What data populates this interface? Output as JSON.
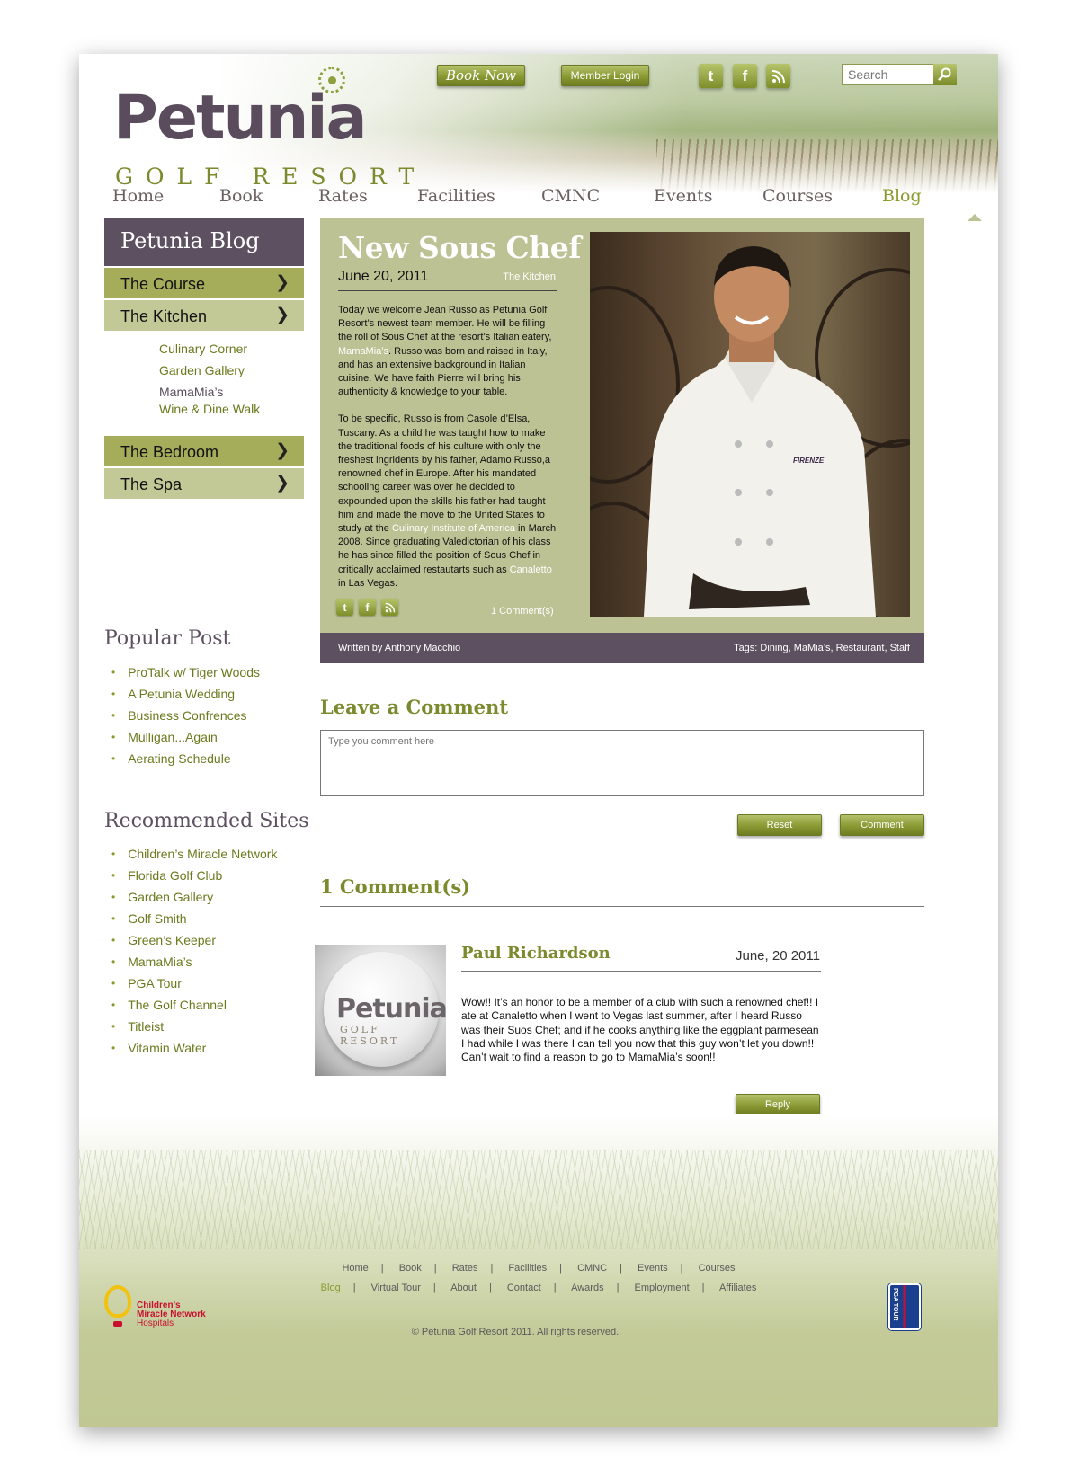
{
  "header": {
    "logo_word": "Petunia",
    "logo_sub": "GOLF RESORT",
    "book_now": "Book Now",
    "member_login": "Member Login",
    "search_placeholder": "Search"
  },
  "nav": [
    "Home",
    "Book",
    "Rates",
    "Facilities",
    "CMNC",
    "Events",
    "Courses",
    "Blog"
  ],
  "sidebar": {
    "title": "Petunia Blog",
    "items": [
      "The Course",
      "The Kitchen",
      "The Bedroom",
      "The Spa"
    ],
    "sub_links": [
      "Culinary Corner",
      "Garden Gallery",
      "MamaMia’s",
      "Wine & Dine Walk"
    ],
    "popular_title": "Popular Post",
    "popular": [
      "ProTalk w/ Tiger Woods",
      "A Petunia Wedding",
      "Business Confrences",
      "Mulligan...Again",
      "Aerating Schedule"
    ],
    "recommended_title": "Recommended Sites",
    "recommended": [
      "Children’s Miracle Network",
      "Florida Golf Club",
      "Garden Gallery",
      "Golf Smith",
      "Green’s Keeper",
      "MamaMia’s",
      "PGA Tour",
      "The Golf Channel",
      "Titleist",
      "Vitamin Water"
    ]
  },
  "post": {
    "title": "New Sous Chef",
    "date": "June 20, 2011",
    "category": "The Kitchen",
    "p1_a": "Today we welcome Jean Russo as Petunia Golf Resort’s newest team member. He will be filling the roll of Sous Chef at the resort’s Italian eatery, ",
    "p1_link": "MamaMia’s",
    "p1_b": ". Russo was born and raised in Italy, and has an extensive background in Italian cuisine. We have faith Pierre will bring his authenticity & knowledge to your table.",
    "p2_a": "To be specific, Russo is from Casole d’Elsa, Tuscany. As a child he was taught how to make the traditional foods of his culture with only the freshest ingridents by his father, Adamo Russo,a renowned chef in Europe. After his mandated schooling career was over he decided to expounded upon the skills his father had taught him and made the move to the United States to study at the ",
    "p2_link": "Culinary Institute of America",
    "p2_b": " in March 2008. Since graduating Valedictorian of his class he has since filled the position of Sous Chef in critically acclaimed restautarts such as ",
    "p2_link2": "Canaletto",
    "p2_c": " in Las Vegas.",
    "comment_count": "1 Comment(s)",
    "written_by": "Written by ",
    "author": "Anthony Macchio",
    "tags_label": "Tags: ",
    "tags": [
      "Dining",
      "MaMia’s",
      "Restaurant",
      "Staff"
    ],
    "chef_badge": "FIRENZE"
  },
  "comment_form": {
    "title": "Leave a Comment",
    "placeholder": "Type you comment here",
    "reset": "Reset",
    "submit": "Comment"
  },
  "comments": {
    "title": "1 Comment(s)",
    "items": [
      {
        "name": "Paul Richardson",
        "date": "June, 20 2011",
        "body": "Wow!! It’s an honor to be a member of a club with such a renowned chef!! I ate at Canaletto when I went to Vegas last summer, after I heard Russo was their Suos Chef; and if he cooks anything like the eggplant parmesean I had while I was there I can tell you now that this guy won’t let you down!! Can’t wait to find a reason to go to MamaMia’s soon!!",
        "reply": "Reply",
        "avatar_word": "Petunia",
        "avatar_sub": "GOLF RESORT"
      }
    ]
  },
  "footer": {
    "row1": [
      "Home",
      "Book",
      "Rates",
      "Facilities",
      "CMNC",
      "Events",
      "Courses"
    ],
    "row2": [
      "Blog",
      "Virtual Tour",
      "About",
      "Contact",
      "Awards",
      "Employment",
      "Affiliates"
    ],
    "copyright": "© Petunia Golf Resort 2011. All rights reserved.",
    "cmn_lines": [
      "Children’s",
      "Miracle Network",
      "Hospitals"
    ],
    "pga": "PGA TOUR"
  },
  "colors": {
    "olive": "#8a9a2c",
    "plum": "#5d5060",
    "panel": "#bcc293"
  },
  "icons": [
    "twitter-icon",
    "facebook-icon",
    "rss-icon",
    "search-icon",
    "chevron-right-icon"
  ]
}
